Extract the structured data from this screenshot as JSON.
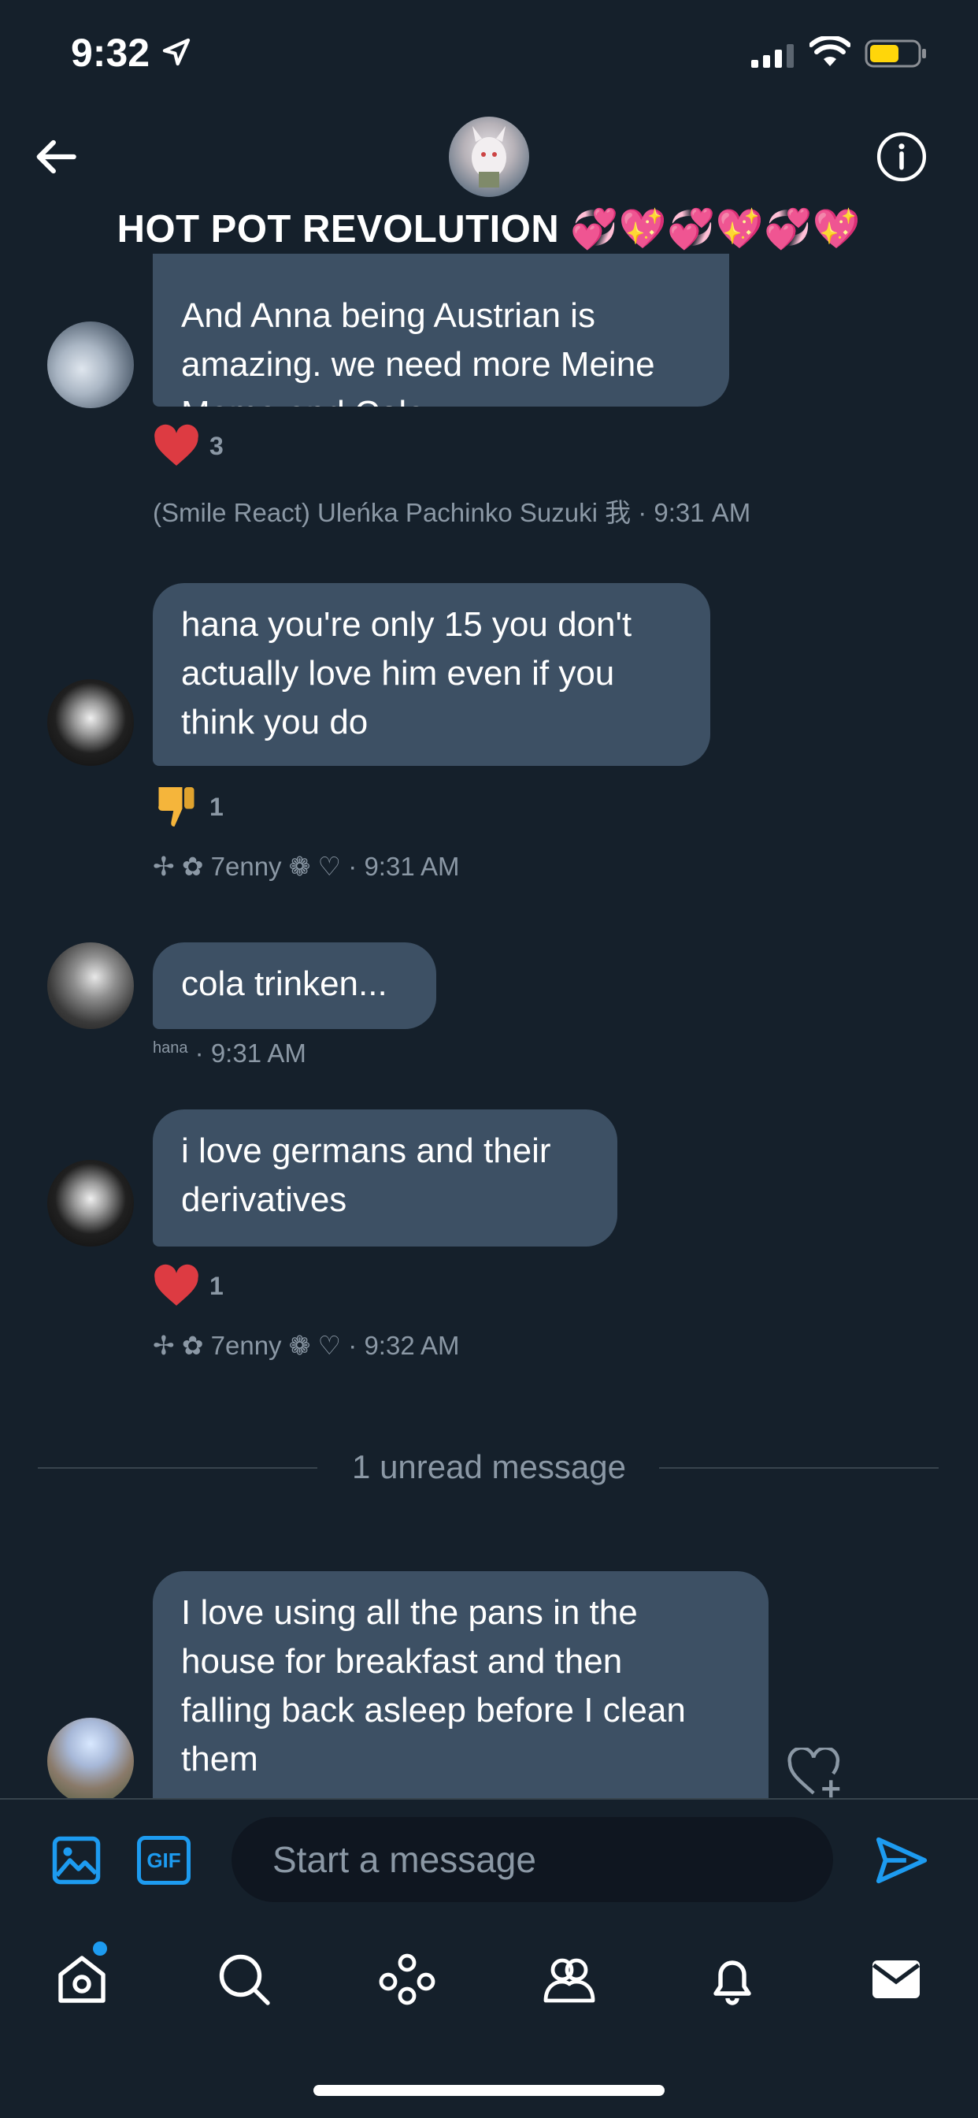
{
  "status_bar": {
    "time": "9:32"
  },
  "header": {
    "title": "HOT POT REVOLUTION 💞💖💞💖💞💖"
  },
  "messages": [
    {
      "text": "And Anna being Austrian is\namazing. we need more Meine\nMama and Cola",
      "reaction": {
        "emoji": "heart",
        "count": "3"
      },
      "meta": "(Smile React) Uleńka Pachinko Suzuki 我 · 9:31 AM"
    },
    {
      "text": "hana you're only 15 you don't\nactually love him even if you\nthink you do",
      "reaction": {
        "emoji": "thumbs-down",
        "count": "1"
      },
      "meta": "✢ ✿ 7enny ❁ ♡ · 9:31 AM"
    },
    {
      "text": "cola trinken...",
      "meta_sender": "hana",
      "meta_time": "· 9:31 AM"
    },
    {
      "text": "i love germans and their\nderivatives",
      "reaction": {
        "emoji": "heart",
        "count": "1"
      },
      "meta": "✢ ✿ 7enny ❁ ♡ · 9:32 AM"
    },
    {
      "text": "I love using all the pans in the\nhouse for breakfast and then\nfalling back asleep before I clean\nthem"
    }
  ],
  "unread_divider": "1 unread message",
  "composer": {
    "gif_label": "GIF",
    "placeholder": "Start a message"
  },
  "colors": {
    "background": "#15202b",
    "bubble": "#3d5064",
    "accent": "#1d9bf0",
    "meta": "#8b98a5",
    "heart": "#e0245e"
  },
  "tabs": [
    "home-icon",
    "search-icon",
    "spaces-icon",
    "communities-icon",
    "notifications-icon",
    "messages-icon"
  ]
}
